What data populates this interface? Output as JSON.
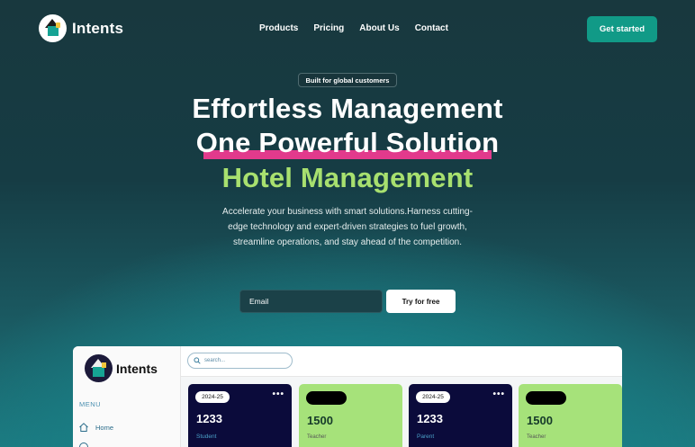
{
  "nav": {
    "brand": "Intents",
    "links": [
      "Products",
      "Pricing",
      "About Us",
      "Contact"
    ],
    "cta_label": "Get started"
  },
  "hero": {
    "badge": "Built for global customers",
    "line1": "Effortless Management",
    "line2": "One Powerful Solution",
    "line3": "Hotel Management",
    "description": "Accelerate your business with smart solutions.Harness cutting-edge technology and expert-driven strategies to fuel growth, streamline operations, and stay ahead of the competition.",
    "email_placeholder": "Email",
    "try_label": "Try for free"
  },
  "dashboard": {
    "brand": "Intents",
    "menu_label": "MENU",
    "menu_items": [
      "Home"
    ],
    "search_placeholder": "search...",
    "cards": [
      {
        "year": "2024-25",
        "value": "1233",
        "label": "Student",
        "style": "dark"
      },
      {
        "value": "1500",
        "label": "Teacher",
        "style": "green"
      },
      {
        "year": "2024-25",
        "value": "1233",
        "label": "Parent",
        "style": "dark"
      },
      {
        "value": "1500",
        "label": "Teacher",
        "style": "green"
      }
    ]
  },
  "colors": {
    "accent_teal": "#119a87",
    "highlight_pink": "#e23a8c",
    "headline_green": "#a8e06f",
    "card_dark": "#0b0b3b",
    "card_green": "#a6e27a"
  }
}
